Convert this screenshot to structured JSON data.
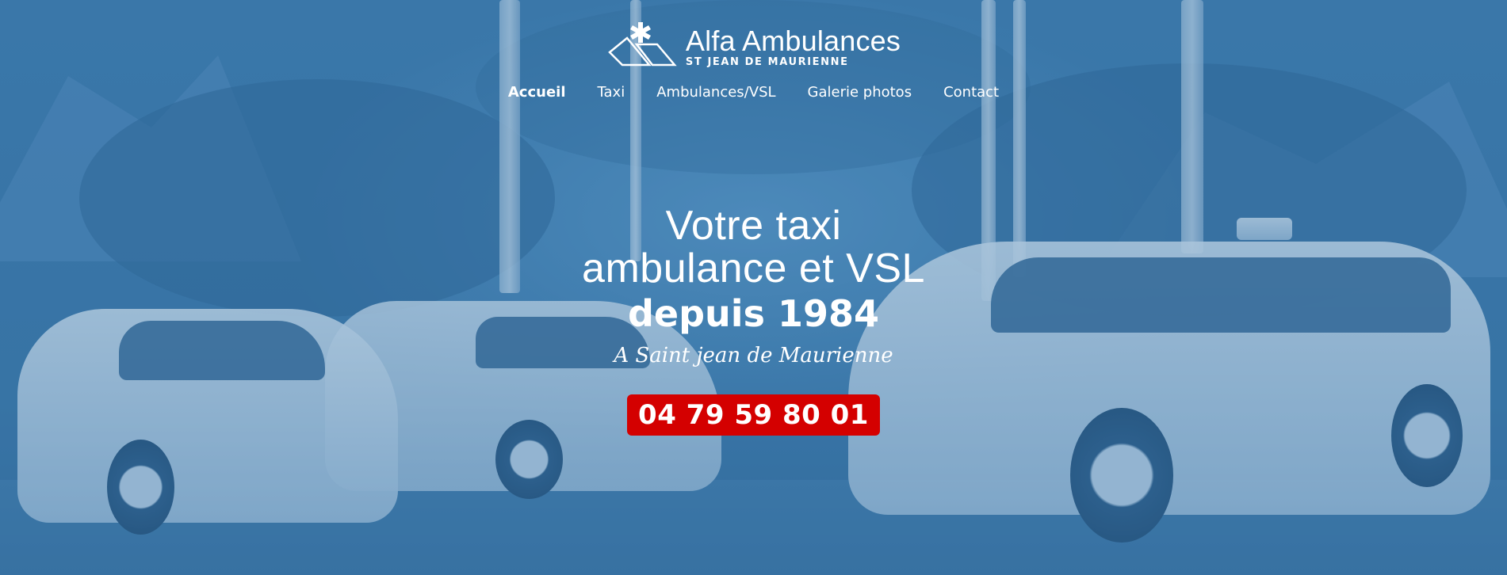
{
  "brand": {
    "name": "Alfa Ambulances",
    "subtitle": "ST JEAN DE MAURIENNE"
  },
  "nav": {
    "items": [
      {
        "label": "Accueil",
        "active": true
      },
      {
        "label": "Taxi",
        "active": false
      },
      {
        "label": "Ambulances/VSL",
        "active": false
      },
      {
        "label": "Galerie photos",
        "active": false
      },
      {
        "label": "Contact",
        "active": false
      }
    ]
  },
  "hero": {
    "line1": "Votre taxi",
    "line2": "ambulance et VSL",
    "line3": "depuis 1984",
    "tagline": "A Saint jean de Maurienne",
    "phone": "04 79 59 80 01"
  },
  "colors": {
    "overlay": "#3e79aa",
    "phone_button": "#d40000",
    "text": "#ffffff"
  }
}
